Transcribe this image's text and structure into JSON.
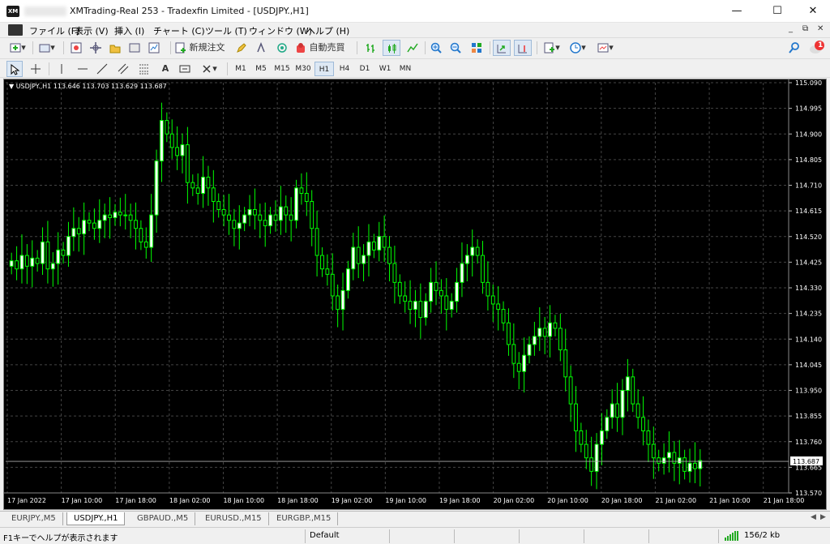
{
  "window": {
    "title": "XMTrading-Real 253 - Tradexfin Limited - [USDJPY.,H1]",
    "minimize_glyph": "—",
    "maximize_glyph": "☐",
    "close_glyph": "✕"
  },
  "menu": {
    "items": [
      "ファイル (F)",
      "表示 (V)",
      "挿入 (I)",
      "チャート (C)",
      "ツール (T)",
      "ウィンドウ (W)",
      "ヘルプ (H)"
    ],
    "mdi_minimize": "_",
    "mdi_restore": "⧉",
    "mdi_close": "✕"
  },
  "toolbar": {
    "new_order_label": "新規注文",
    "autotrading_label": "自動売買",
    "notification_count": "1",
    "text_tool": "A",
    "timeframes": [
      "M1",
      "M5",
      "M15",
      "M30",
      "H1",
      "H4",
      "D1",
      "W1",
      "MN"
    ],
    "active_timeframe": "H1"
  },
  "chart_header": "USDJPY.,H1  113.646 113.703 113.629 113.687",
  "chart_data": {
    "type": "candlestick",
    "symbol": "USDJPY.",
    "timeframe": "H1",
    "bull_color": "#00ff00",
    "bear_color": "#00ff00",
    "bull_fill": "#ffffff",
    "background": "#000000",
    "grid": true,
    "current_price": "113.687",
    "y_ticks": [
      "115.090",
      "114.995",
      "114.900",
      "114.805",
      "114.710",
      "114.615",
      "114.520",
      "114.425",
      "114.330",
      "114.235",
      "114.140",
      "114.045",
      "113.950",
      "113.855",
      "113.760",
      "113.665",
      "113.570"
    ],
    "y_range": [
      113.57,
      115.09
    ],
    "x_ticks": [
      "17 Jan 2022",
      "17 Jan 10:00",
      "17 Jan 18:00",
      "18 Jan 02:00",
      "18 Jan 10:00",
      "18 Jan 18:00",
      "19 Jan 02:00",
      "19 Jan 10:00",
      "19 Jan 18:00",
      "20 Jan 02:00",
      "20 Jan 10:00",
      "20 Jan 18:00",
      "21 Jan 02:00",
      "21 Jan 10:00",
      "21 Jan 18:00"
    ],
    "closes": [
      114.43,
      114.4,
      114.45,
      114.41,
      114.44,
      114.42,
      114.5,
      114.4,
      114.42,
      114.47,
      114.45,
      114.52,
      114.55,
      114.53,
      114.58,
      114.57,
      114.55,
      114.58,
      114.6,
      114.59,
      114.61,
      114.6,
      114.6,
      114.58,
      114.55,
      114.5,
      114.48,
      114.6,
      114.8,
      114.95,
      114.9,
      114.85,
      114.82,
      114.86,
      114.72,
      114.7,
      114.68,
      114.74,
      114.7,
      114.65,
      114.62,
      114.6,
      114.58,
      114.55,
      114.57,
      114.6,
      114.62,
      114.6,
      114.58,
      114.56,
      114.6,
      114.58,
      114.63,
      114.6,
      114.58,
      114.7,
      114.68,
      114.65,
      114.55,
      114.45,
      114.4,
      114.38,
      114.3,
      114.25,
      114.32,
      114.4,
      114.48,
      114.42,
      114.45,
      114.5,
      114.47,
      114.52,
      114.48,
      114.42,
      114.35,
      114.3,
      114.28,
      114.25,
      114.28,
      114.22,
      114.28,
      114.35,
      114.32,
      114.3,
      114.25,
      114.28,
      114.35,
      114.42,
      114.45,
      114.48,
      114.45,
      114.35,
      114.3,
      114.27,
      114.25,
      114.2,
      114.12,
      114.05,
      114.02,
      114.08,
      114.12,
      114.15,
      114.18,
      114.15,
      114.2,
      114.18,
      114.1,
      114.0,
      113.9,
      113.8,
      113.75,
      113.7,
      113.65,
      113.75,
      113.8,
      113.85,
      113.9,
      113.85,
      113.95,
      114.0,
      113.9,
      113.85,
      113.8,
      113.75,
      113.7,
      113.68,
      113.7,
      113.72,
      113.68,
      113.7,
      113.65,
      113.68,
      113.66,
      113.69
    ]
  },
  "tabs": [
    "EURJPY.,M5",
    "USDJPY.,H1",
    "GBPAUD.,M5",
    "EURUSD.,M15",
    "EURGBP.,M15"
  ],
  "active_tab": "USDJPY.,H1",
  "status": {
    "help": "F1キーでヘルプが表示されます",
    "profile": "Default",
    "traffic": "156/2 kb"
  }
}
